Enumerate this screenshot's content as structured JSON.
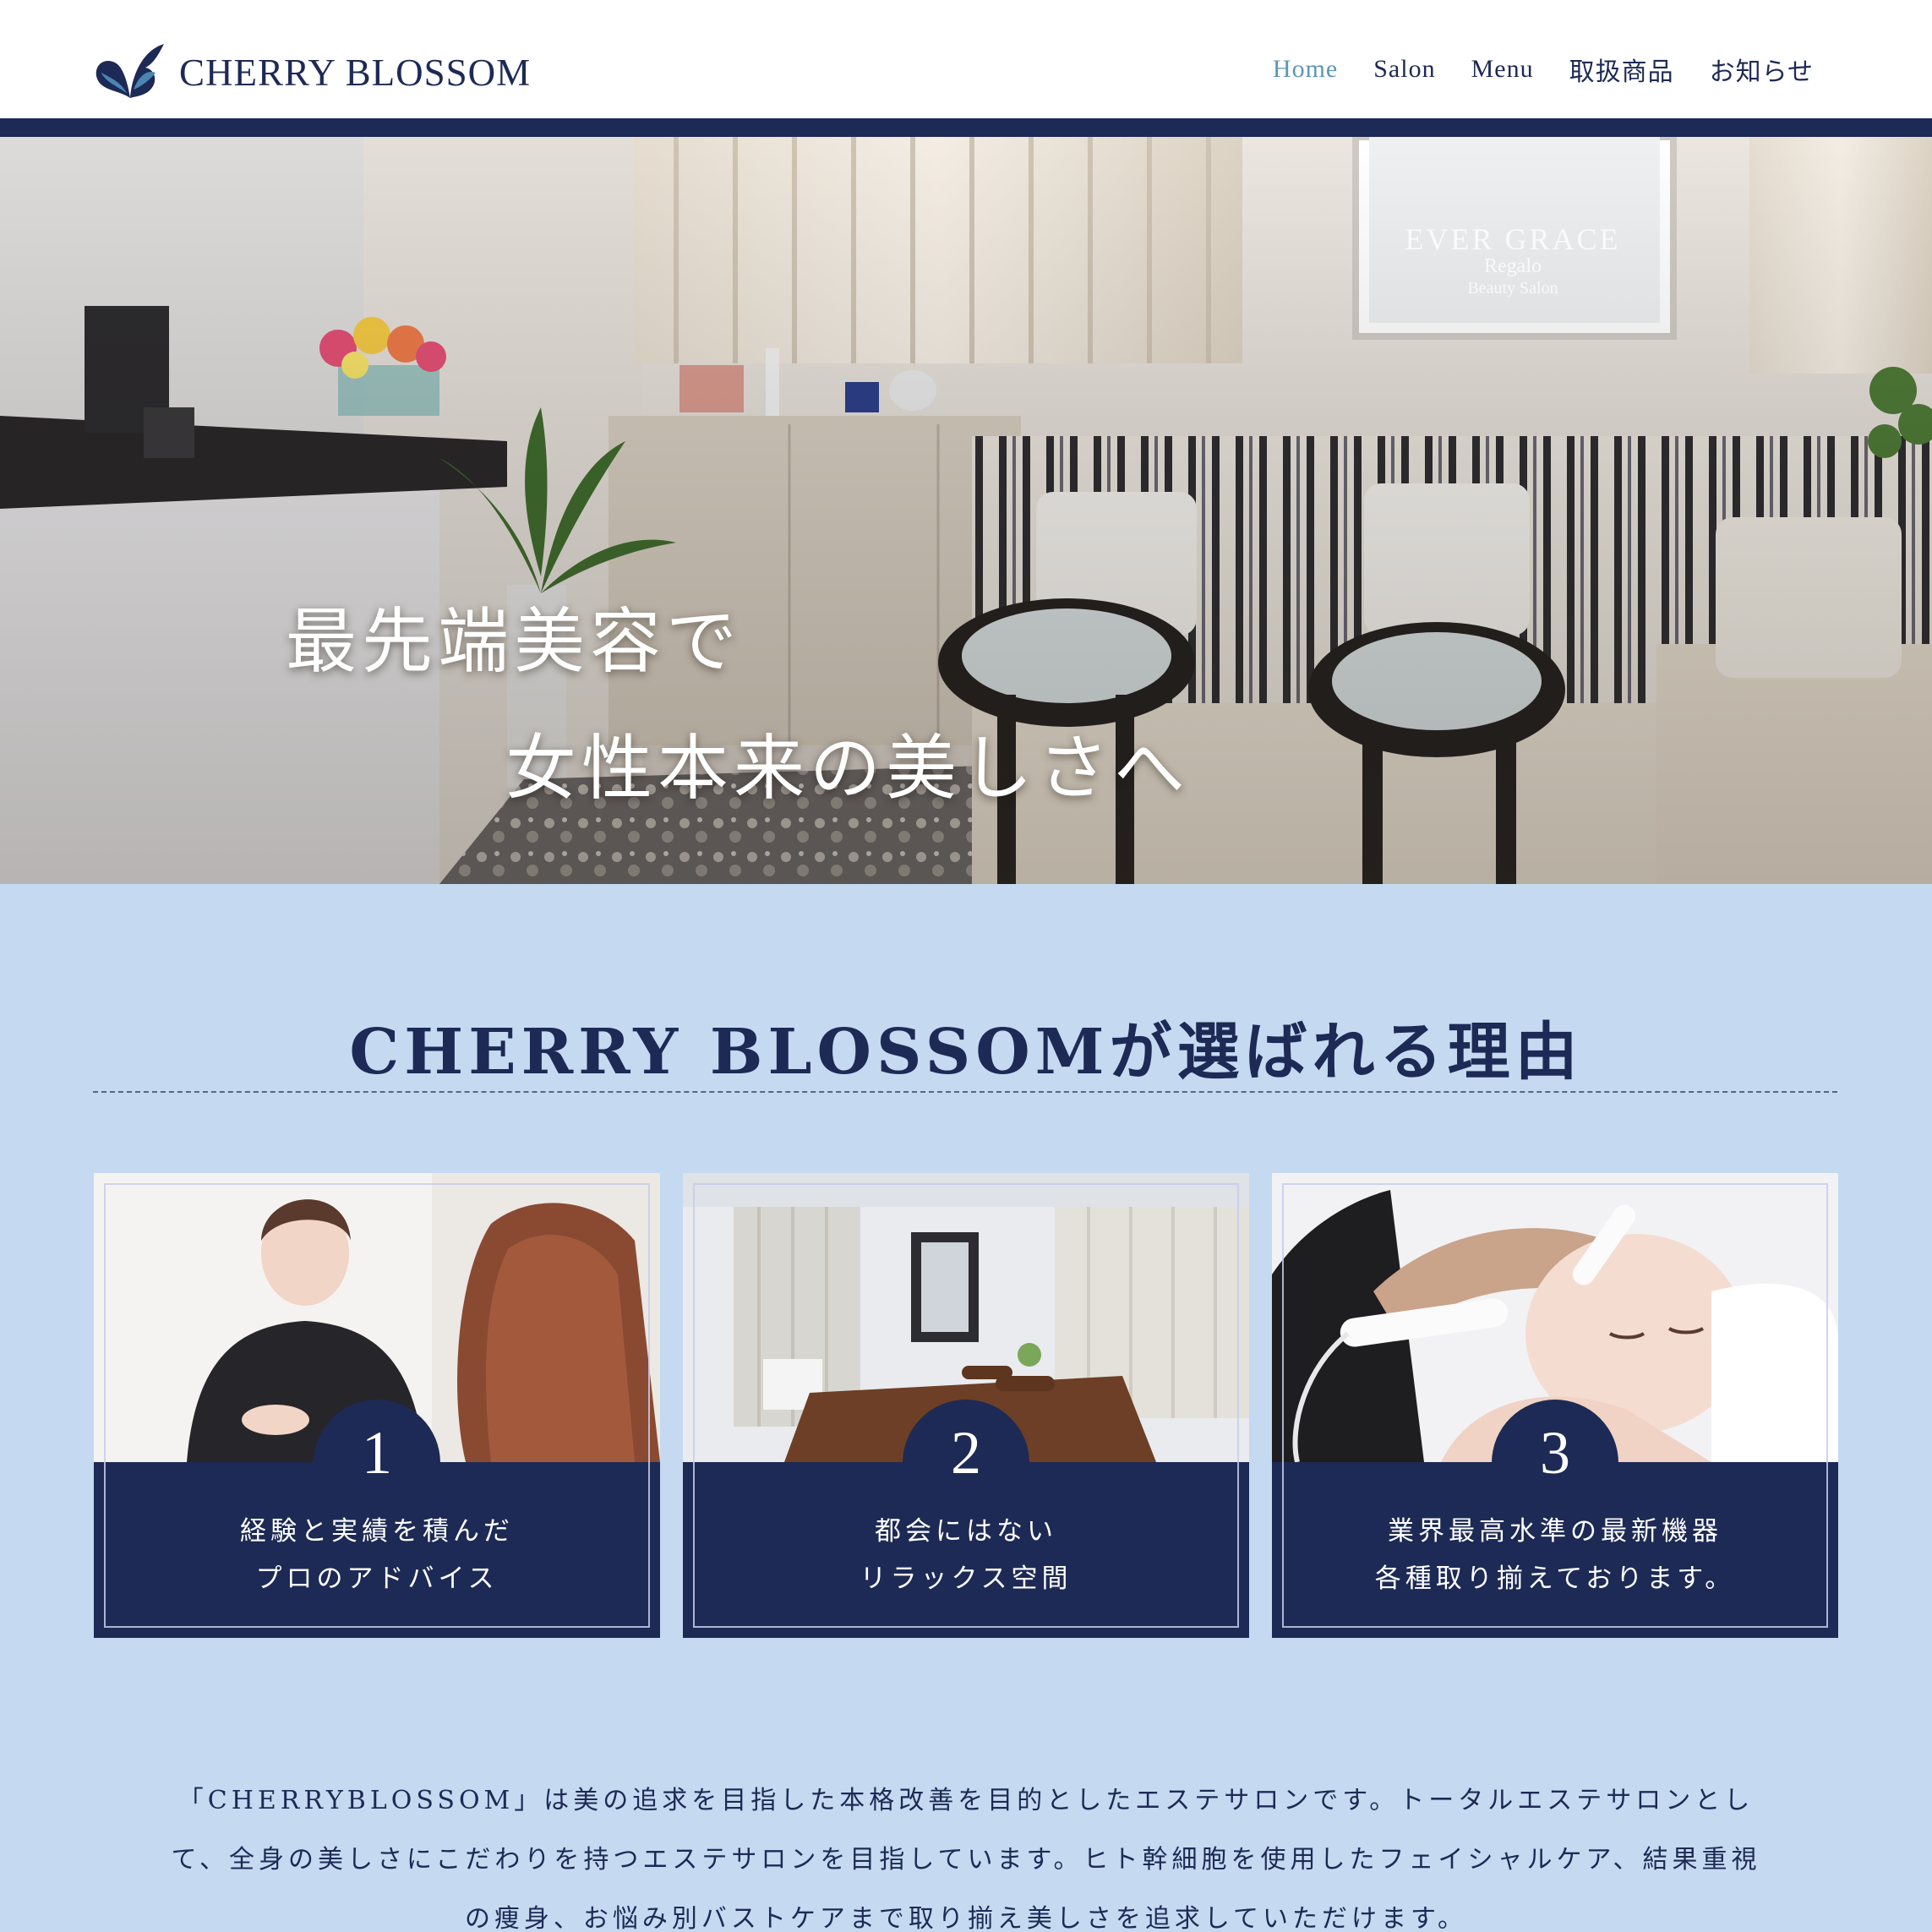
{
  "site": {
    "brand": "CHERRY BLOSSOM"
  },
  "nav": {
    "items": [
      "Home",
      "Salon",
      "Menu",
      "取扱商品",
      "お知らせ"
    ],
    "active": "Home"
  },
  "hero": {
    "line1": "最先端美容で",
    "line2": "女性本来の美しさへ",
    "sign_brand": "EVER GRACE",
    "sign_sub": "Regalo",
    "sign_sub2": "Beauty Salon"
  },
  "reasons": {
    "title": "CHERRY BLOSSOMが選ばれる理由",
    "cards": [
      {
        "number": "1",
        "line1": "経験と実績を積んだ",
        "line2": "プロのアドバイス"
      },
      {
        "number": "2",
        "line1": "都会にはない",
        "line2": "リラックス空間"
      },
      {
        "number": "3",
        "line1": "業界最高水準の最新機器",
        "line2": "各種取り揃えております。"
      }
    ]
  },
  "intro": {
    "lines": [
      "「CHERRYBLOSSOM」は美の追求を目指した本格改善を目的としたエステサロンです。トータルエステサロンとし",
      "て、全身の美しさにこだわりを持つエステサロンを目指しています。ヒト幹細胞を使用したフェイシャルケア、結果重視",
      "の痩身、お悩み別バストケアまで取り揃え美しさを追求していただけます。"
    ]
  },
  "colors": {
    "navy": "#1d2a55",
    "accent": "#5d97b4",
    "background": "#c5daf1"
  }
}
